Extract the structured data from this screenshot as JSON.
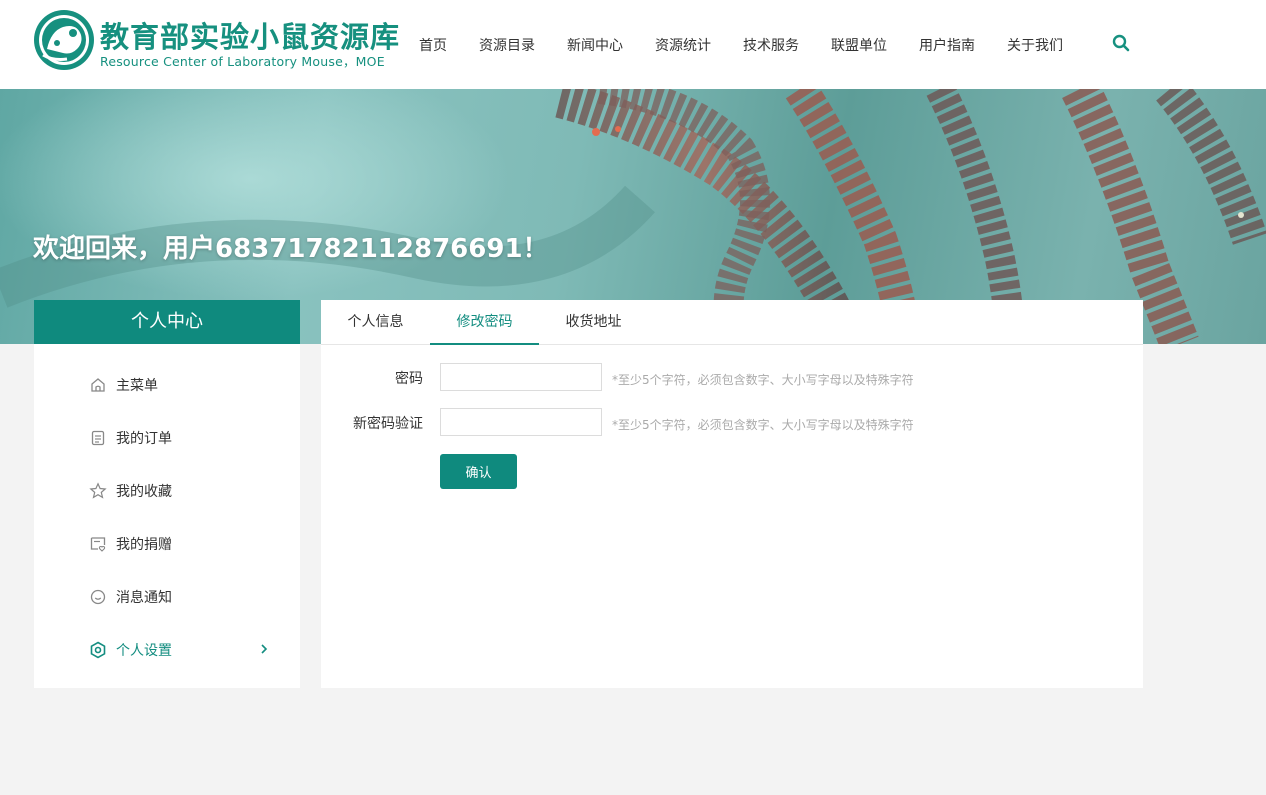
{
  "header": {
    "logo_cn": "教育部实验小鼠资源库",
    "logo_en": "Resource Center of Laboratory Mouse，MOE",
    "nav": [
      "首页",
      "资源目录",
      "新闻中心",
      "资源统计",
      "技术服务",
      "联盟单位",
      "用户指南",
      "关于我们"
    ]
  },
  "banner": {
    "welcome": "欢迎回来，用户68371782112876691！"
  },
  "sidebar": {
    "title": "个人中心",
    "items": [
      {
        "label": "主菜单",
        "icon": "home-icon"
      },
      {
        "label": "我的订单",
        "icon": "clipboard-icon"
      },
      {
        "label": "我的收藏",
        "icon": "star-icon"
      },
      {
        "label": "我的捐赠",
        "icon": "donation-icon"
      },
      {
        "label": "消息通知",
        "icon": "message-icon"
      },
      {
        "label": "个人设置",
        "icon": "settings-icon",
        "active": true
      }
    ]
  },
  "tabs": [
    {
      "label": "个人信息"
    },
    {
      "label": "修改密码",
      "active": true
    },
    {
      "label": "收货地址"
    }
  ],
  "form": {
    "password_label": "密码",
    "password_value": "",
    "password_hint": "*至少5个字符，必须包含数字、大小写字母以及特殊字符",
    "confirm_label": "新密码验证",
    "confirm_value": "",
    "confirm_hint": "*至少5个字符，必须包含数字、大小写字母以及特殊字符",
    "submit_label": "确认"
  },
  "colors": {
    "accent": "#0f8a7e",
    "background": "#f3f3f3"
  }
}
